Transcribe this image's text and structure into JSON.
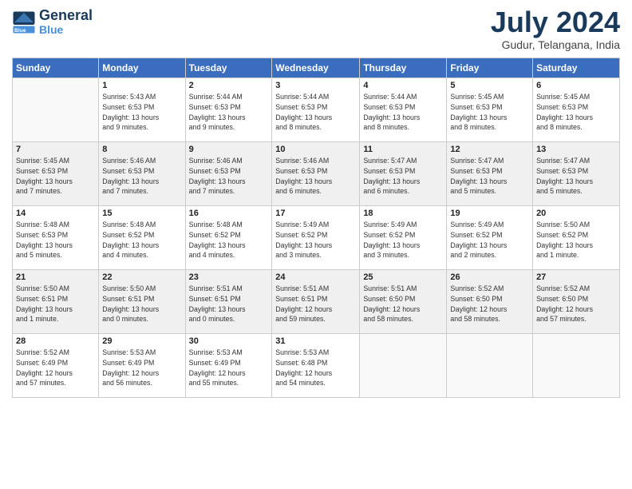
{
  "header": {
    "logo_line1": "General",
    "logo_line2": "Blue",
    "month": "July 2024",
    "location": "Gudur, Telangana, India"
  },
  "weekdays": [
    "Sunday",
    "Monday",
    "Tuesday",
    "Wednesday",
    "Thursday",
    "Friday",
    "Saturday"
  ],
  "weeks": [
    [
      {
        "num": "",
        "info": ""
      },
      {
        "num": "1",
        "info": "Sunrise: 5:43 AM\nSunset: 6:53 PM\nDaylight: 13 hours\nand 9 minutes."
      },
      {
        "num": "2",
        "info": "Sunrise: 5:44 AM\nSunset: 6:53 PM\nDaylight: 13 hours\nand 9 minutes."
      },
      {
        "num": "3",
        "info": "Sunrise: 5:44 AM\nSunset: 6:53 PM\nDaylight: 13 hours\nand 8 minutes."
      },
      {
        "num": "4",
        "info": "Sunrise: 5:44 AM\nSunset: 6:53 PM\nDaylight: 13 hours\nand 8 minutes."
      },
      {
        "num": "5",
        "info": "Sunrise: 5:45 AM\nSunset: 6:53 PM\nDaylight: 13 hours\nand 8 minutes."
      },
      {
        "num": "6",
        "info": "Sunrise: 5:45 AM\nSunset: 6:53 PM\nDaylight: 13 hours\nand 8 minutes."
      }
    ],
    [
      {
        "num": "7",
        "info": "Sunrise: 5:45 AM\nSunset: 6:53 PM\nDaylight: 13 hours\nand 7 minutes."
      },
      {
        "num": "8",
        "info": "Sunrise: 5:46 AM\nSunset: 6:53 PM\nDaylight: 13 hours\nand 7 minutes."
      },
      {
        "num": "9",
        "info": "Sunrise: 5:46 AM\nSunset: 6:53 PM\nDaylight: 13 hours\nand 7 minutes."
      },
      {
        "num": "10",
        "info": "Sunrise: 5:46 AM\nSunset: 6:53 PM\nDaylight: 13 hours\nand 6 minutes."
      },
      {
        "num": "11",
        "info": "Sunrise: 5:47 AM\nSunset: 6:53 PM\nDaylight: 13 hours\nand 6 minutes."
      },
      {
        "num": "12",
        "info": "Sunrise: 5:47 AM\nSunset: 6:53 PM\nDaylight: 13 hours\nand 5 minutes."
      },
      {
        "num": "13",
        "info": "Sunrise: 5:47 AM\nSunset: 6:53 PM\nDaylight: 13 hours\nand 5 minutes."
      }
    ],
    [
      {
        "num": "14",
        "info": "Sunrise: 5:48 AM\nSunset: 6:53 PM\nDaylight: 13 hours\nand 5 minutes."
      },
      {
        "num": "15",
        "info": "Sunrise: 5:48 AM\nSunset: 6:52 PM\nDaylight: 13 hours\nand 4 minutes."
      },
      {
        "num": "16",
        "info": "Sunrise: 5:48 AM\nSunset: 6:52 PM\nDaylight: 13 hours\nand 4 minutes."
      },
      {
        "num": "17",
        "info": "Sunrise: 5:49 AM\nSunset: 6:52 PM\nDaylight: 13 hours\nand 3 minutes."
      },
      {
        "num": "18",
        "info": "Sunrise: 5:49 AM\nSunset: 6:52 PM\nDaylight: 13 hours\nand 3 minutes."
      },
      {
        "num": "19",
        "info": "Sunrise: 5:49 AM\nSunset: 6:52 PM\nDaylight: 13 hours\nand 2 minutes."
      },
      {
        "num": "20",
        "info": "Sunrise: 5:50 AM\nSunset: 6:52 PM\nDaylight: 13 hours\nand 1 minute."
      }
    ],
    [
      {
        "num": "21",
        "info": "Sunrise: 5:50 AM\nSunset: 6:51 PM\nDaylight: 13 hours\nand 1 minute."
      },
      {
        "num": "22",
        "info": "Sunrise: 5:50 AM\nSunset: 6:51 PM\nDaylight: 13 hours\nand 0 minutes."
      },
      {
        "num": "23",
        "info": "Sunrise: 5:51 AM\nSunset: 6:51 PM\nDaylight: 13 hours\nand 0 minutes."
      },
      {
        "num": "24",
        "info": "Sunrise: 5:51 AM\nSunset: 6:51 PM\nDaylight: 12 hours\nand 59 minutes."
      },
      {
        "num": "25",
        "info": "Sunrise: 5:51 AM\nSunset: 6:50 PM\nDaylight: 12 hours\nand 58 minutes."
      },
      {
        "num": "26",
        "info": "Sunrise: 5:52 AM\nSunset: 6:50 PM\nDaylight: 12 hours\nand 58 minutes."
      },
      {
        "num": "27",
        "info": "Sunrise: 5:52 AM\nSunset: 6:50 PM\nDaylight: 12 hours\nand 57 minutes."
      }
    ],
    [
      {
        "num": "28",
        "info": "Sunrise: 5:52 AM\nSunset: 6:49 PM\nDaylight: 12 hours\nand 57 minutes."
      },
      {
        "num": "29",
        "info": "Sunrise: 5:53 AM\nSunset: 6:49 PM\nDaylight: 12 hours\nand 56 minutes."
      },
      {
        "num": "30",
        "info": "Sunrise: 5:53 AM\nSunset: 6:49 PM\nDaylight: 12 hours\nand 55 minutes."
      },
      {
        "num": "31",
        "info": "Sunrise: 5:53 AM\nSunset: 6:48 PM\nDaylight: 12 hours\nand 54 minutes."
      },
      {
        "num": "",
        "info": ""
      },
      {
        "num": "",
        "info": ""
      },
      {
        "num": "",
        "info": ""
      }
    ]
  ]
}
